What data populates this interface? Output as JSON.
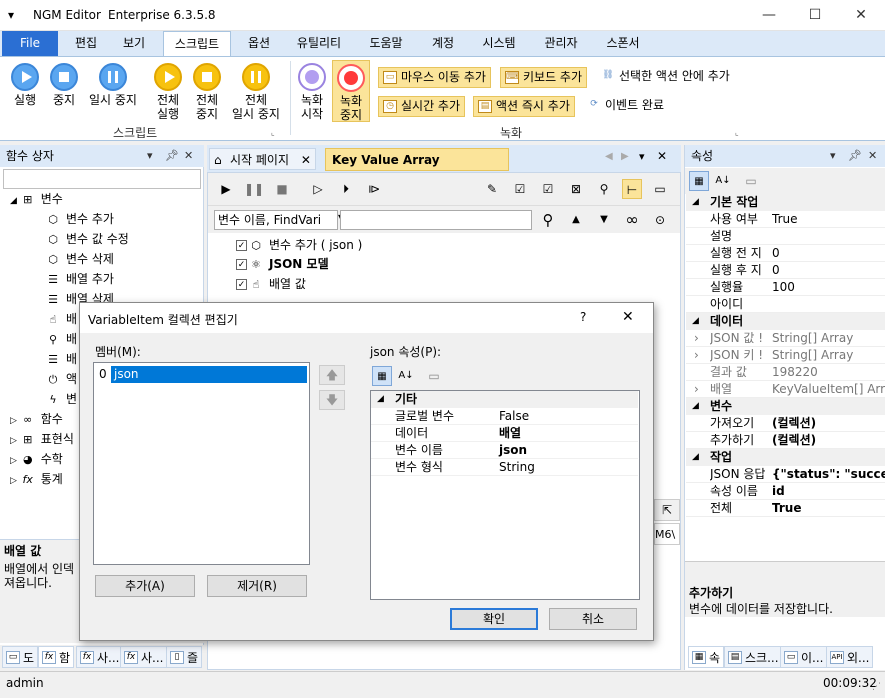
{
  "window": {
    "app_name": "NGM Editor",
    "edition": "Enterprise 6.3.5.8",
    "minimize": "—",
    "maximize": "☐",
    "close": "✕"
  },
  "menu": [
    "File",
    "편집",
    "보기",
    "스크립트",
    "옵션",
    "유틸리티",
    "도움말",
    "계정",
    "시스템",
    "관리자",
    "스폰서"
  ],
  "menu_active": "스크립트",
  "ribbon": {
    "script_group": {
      "label": "스크립트",
      "run": "실행",
      "stop": "중지",
      "pause": "일시 중지",
      "all_run": [
        "전체",
        "실행"
      ],
      "all_stop": [
        "전체",
        "중지"
      ],
      "all_pause": [
        "전체",
        "일시 중지"
      ]
    },
    "record_group": {
      "label": "녹화",
      "record_start": [
        "녹화",
        "시작"
      ],
      "record_stop": [
        "녹화",
        "중지"
      ],
      "mouse_move": "마우스 이동 추가",
      "keyboard": "키보드 추가",
      "action_in": "선택한 액션 안에 추가",
      "realtime": "실시간 추가",
      "action_now": "액션 즉시 추가",
      "event_done": "이벤트 완료"
    }
  },
  "left_panel": {
    "title": "함수 상자",
    "tree": [
      {
        "label": "변수",
        "level": 0,
        "expanded": true
      },
      {
        "label": "변수 추가",
        "level": 1
      },
      {
        "label": "변수 값 수정",
        "level": 1
      },
      {
        "label": "변수 삭제",
        "level": 1
      },
      {
        "label": "배열 추가",
        "level": 1
      },
      {
        "label": "배열 삭제",
        "level": 1
      },
      {
        "label": "배",
        "level": 1
      },
      {
        "label": "배",
        "level": 1
      },
      {
        "label": "배",
        "level": 1
      },
      {
        "label": "액",
        "level": 1
      },
      {
        "label": "변",
        "level": 1
      },
      {
        "label": "함수",
        "level": 0
      },
      {
        "label": "표현식",
        "level": 0
      },
      {
        "label": "수학",
        "level": 0
      },
      {
        "label": "통계",
        "level": 0
      }
    ],
    "desc_title": "배열 값",
    "desc_text": [
      "배열에서 인덱",
      "져옵니다."
    ],
    "bottom_tabs": [
      "도",
      "함",
      "사...",
      "사...",
      "즐"
    ]
  },
  "doc_tabs": [
    "시작 페이지",
    "Key Value Array Examples"
  ],
  "doc_active": "Key Value Array Examples",
  "doc": {
    "variable_select": "변수 이름, FindVari",
    "search_value": "",
    "script_items": [
      {
        "label": "변수 추가 ( json )",
        "bold": false
      },
      {
        "label": "JSON 모델",
        "bold": true
      },
      {
        "label": "배열 값",
        "bold": false
      }
    ],
    "partial_text": "M6\\"
  },
  "right_panel": {
    "title": "속성",
    "categories": [
      {
        "name": "기본 작업",
        "rows": [
          [
            "사용 여부",
            "True"
          ],
          [
            "설명",
            ""
          ],
          [
            "실행 전 지",
            "0"
          ],
          [
            "실행 후 지",
            "0"
          ],
          [
            "실행율",
            "100"
          ],
          [
            "아이디",
            ""
          ]
        ]
      },
      {
        "name": "데이터",
        "rows": [
          [
            "JSON 값 !",
            "String[] Array"
          ],
          [
            "JSON 키 !",
            "String[] Array"
          ],
          [
            "결과 값",
            "198220"
          ],
          [
            "배열",
            "KeyValueItem[] Arra"
          ]
        ]
      },
      {
        "name": "변수",
        "rows": [
          [
            "가져오기",
            "(컬렉션)"
          ],
          [
            "추가하기",
            "(컬렉션)"
          ]
        ]
      },
      {
        "name": "작업",
        "rows": [
          [
            "JSON 응답",
            "{\"status\": \"succe"
          ],
          [
            "속성 이름",
            "id"
          ],
          [
            "전체",
            "True"
          ]
        ]
      }
    ],
    "desc_title": "추가하기",
    "desc_text": "변수에 데이터를 저장합니다.",
    "bottom_tabs": [
      "속",
      "스크...",
      "이...",
      "외..."
    ]
  },
  "dialog": {
    "title": "VariableItem 컬렉션 편집기",
    "help": "?",
    "close": "✕",
    "members_label": "멤버(M):",
    "members": [
      {
        "index": "0",
        "name": "json"
      }
    ],
    "props_label": "json 속성(P):",
    "category": "기타",
    "props": [
      [
        "글로벌 변수",
        "False"
      ],
      [
        "데이터",
        "배열"
      ],
      [
        "변수 이름",
        "json"
      ],
      [
        "변수 형식",
        "String"
      ]
    ],
    "add": "추가(A)",
    "remove": "제거(R)",
    "ok": "확인",
    "cancel": "취소"
  },
  "status": {
    "user": "admin",
    "time": "00:09:32"
  }
}
